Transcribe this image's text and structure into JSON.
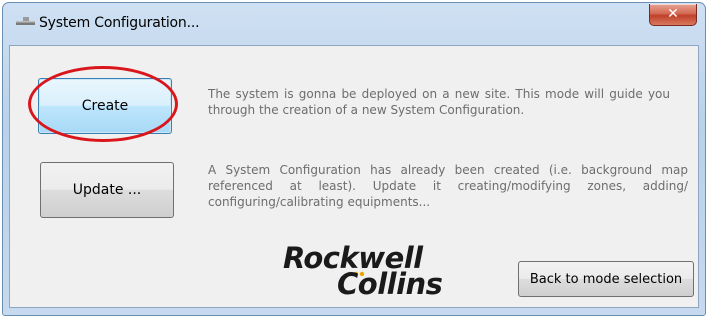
{
  "window": {
    "title": "System Configuration...",
    "close_label": "✕"
  },
  "create": {
    "button_label": "Create",
    "description": "The system is gonna be deployed on a new site. This mode will guide you through the creation of a new System Configuration."
  },
  "update": {
    "button_label": "Update ...",
    "description": "A System Configuration has already been created (i.e. background map referenced at least). Update it creating/modifying zones, adding/ configuring/calibrating equipments..."
  },
  "logo": {
    "line1": "Rockwell",
    "line2": "Collins",
    "accent_color": "#e8a700"
  },
  "footer": {
    "back_label": "Back to mode selection"
  },
  "annotation": {
    "highlight_color": "#d9161c"
  }
}
